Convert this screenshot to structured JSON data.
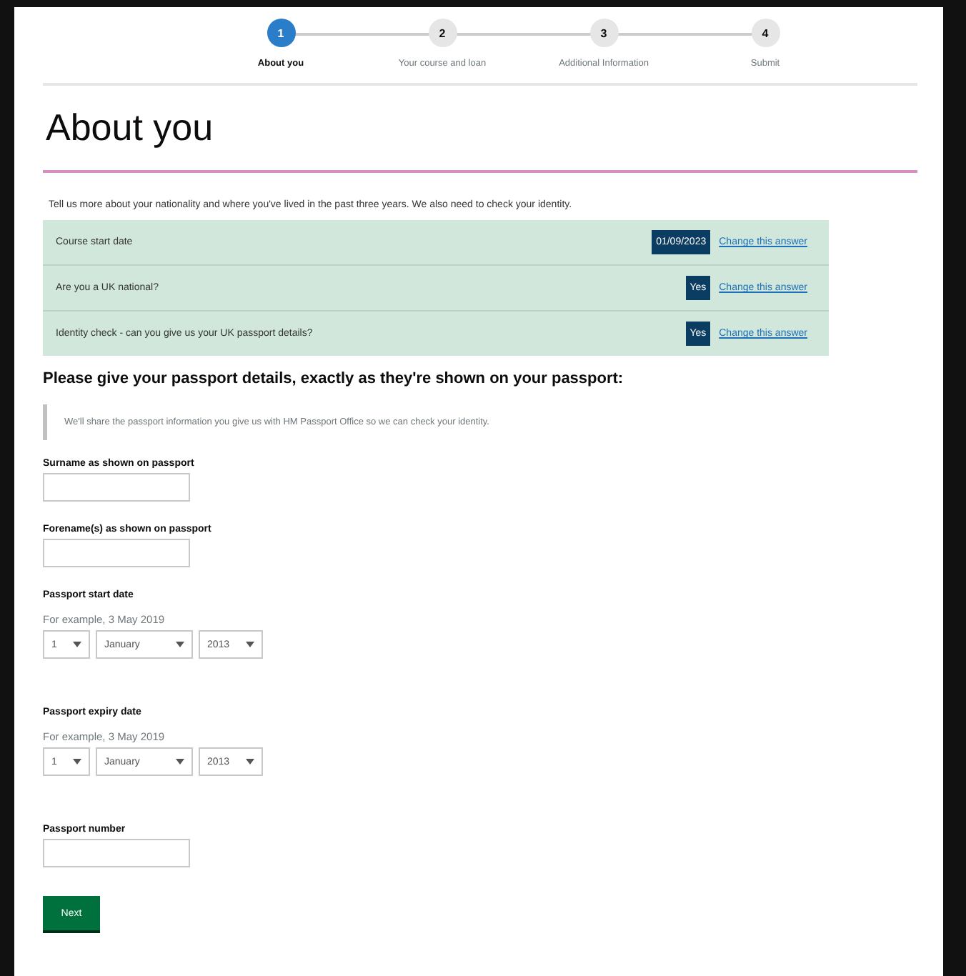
{
  "steps": [
    {
      "number": "1",
      "label": "About you",
      "current": true
    },
    {
      "number": "2",
      "label": "Your course and loan",
      "current": false
    },
    {
      "number": "3",
      "label": "Additional Information",
      "current": false
    },
    {
      "number": "4",
      "label": "Submit",
      "current": false
    }
  ],
  "title": "About you",
  "intro": "Tell us more about your nationality and where you've lived in the past three years. We also need to check your identity.",
  "summary": [
    {
      "question": "Course start date",
      "answer": "01/09/2023",
      "link": "Change this answer"
    },
    {
      "question": "Are you a UK national?",
      "answer": "Yes",
      "link": "Change this answer"
    },
    {
      "question": "Identity check - can you give us your UK passport details?",
      "answer": "Yes",
      "link": "Change this answer"
    }
  ],
  "heading": "Please give your passport details, exactly as they're shown on your passport:",
  "inset": "We'll share the passport information you give us with HM Passport Office so we can check your identity.",
  "fields": [
    {
      "kind": "text",
      "label": "Surname as shown on passport"
    },
    {
      "kind": "text",
      "label": "Forename(s) as shown on passport"
    },
    {
      "kind": "date",
      "label": "Passport start date",
      "hint": "For example, 3 May 2019",
      "day": "1",
      "month": "January",
      "year": "2013"
    },
    {
      "kind": "date",
      "label": "Passport expiry date",
      "hint": "For example, 3 May 2019",
      "day": "1",
      "month": "January",
      "year": "2013"
    },
    {
      "kind": "text",
      "label": "Passport number"
    }
  ],
  "button": "Next"
}
